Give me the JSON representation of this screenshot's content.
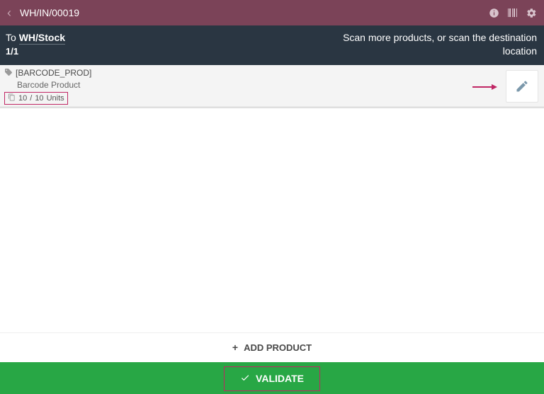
{
  "topbar": {
    "title": "WH/IN/00019"
  },
  "subbar": {
    "to_label": "To",
    "location": "WH/Stock",
    "counter": "1/1",
    "hint": "Scan more products, or scan the destination location"
  },
  "product": {
    "code": "[BARCODE_PROD]",
    "name": "Barcode Product",
    "qty_done": "10",
    "qty_sep": "/",
    "qty_total": "10",
    "uom": "Units"
  },
  "buttons": {
    "add_product": "ADD PRODUCT",
    "validate": "VALIDATE"
  }
}
